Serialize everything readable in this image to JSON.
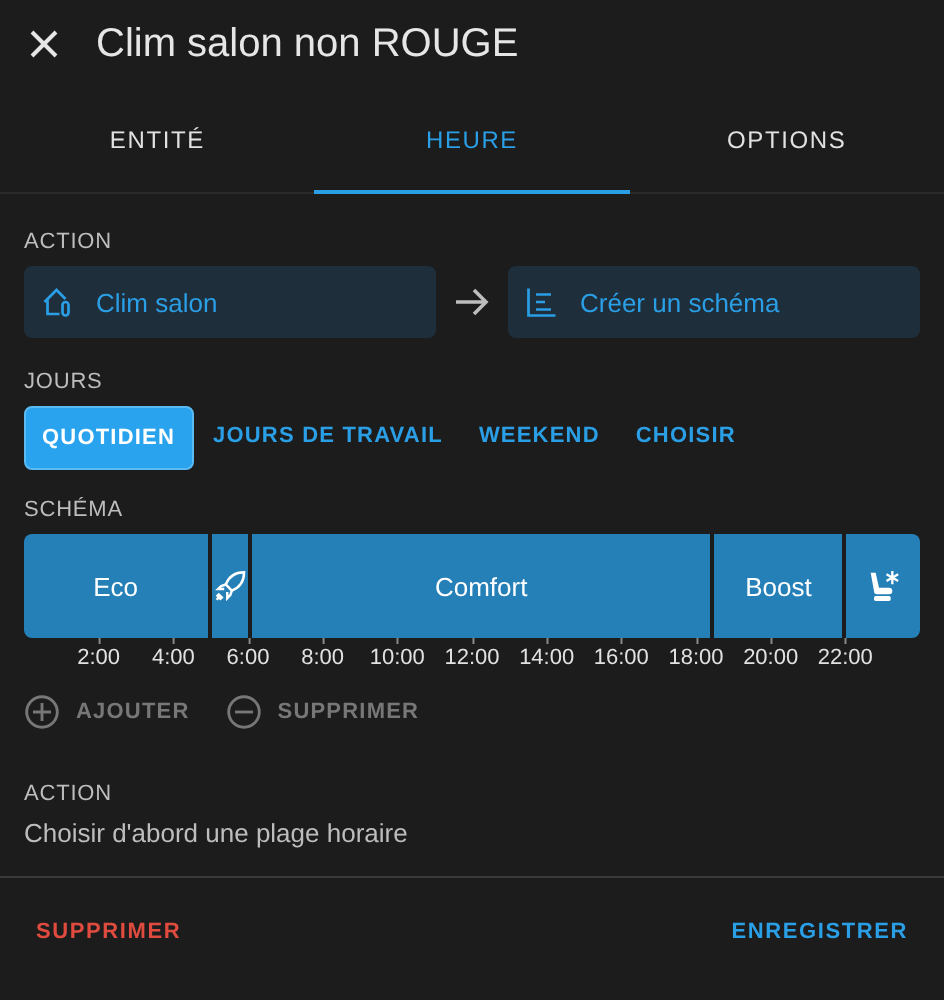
{
  "dialog": {
    "title": "Clim salon non ROUGE"
  },
  "tabs": [
    {
      "label": "ENTITÉ",
      "selected": false
    },
    {
      "label": "HEURE",
      "selected": true
    },
    {
      "label": "OPTIONS",
      "selected": false
    }
  ],
  "action": {
    "label": "ACTION",
    "entity": "Clim salon",
    "service": "Créer un schéma"
  },
  "days": {
    "label": "JOURS",
    "options": [
      {
        "label": "QUOTIDIEN",
        "selected": true
      },
      {
        "label": "JOURS DE TRAVAIL",
        "selected": false
      },
      {
        "label": "WEEKEND",
        "selected": false
      },
      {
        "label": "CHOISIR",
        "selected": false
      }
    ]
  },
  "schedule": {
    "label": "SCHÉMA",
    "segments": [
      {
        "kind": "text",
        "text": "Eco"
      },
      {
        "kind": "rocket"
      },
      {
        "kind": "text",
        "text": "Comfort"
      },
      {
        "kind": "text",
        "text": "Boost"
      },
      {
        "kind": "seat"
      }
    ],
    "ticks": [
      "2:00",
      "4:00",
      "6:00",
      "8:00",
      "10:00",
      "12:00",
      "14:00",
      "16:00",
      "18:00",
      "20:00",
      "22:00"
    ],
    "add": {
      "label": "AJOUTER",
      "disabled": true
    },
    "remove": {
      "label": "SUPPRIMER",
      "disabled": true
    }
  },
  "slot_action": {
    "label": "ACTION",
    "hint": "Choisir d'abord une plage horaire"
  },
  "footer": {
    "delete": "SUPPRIMER",
    "save": "ENREGISTRER"
  }
}
